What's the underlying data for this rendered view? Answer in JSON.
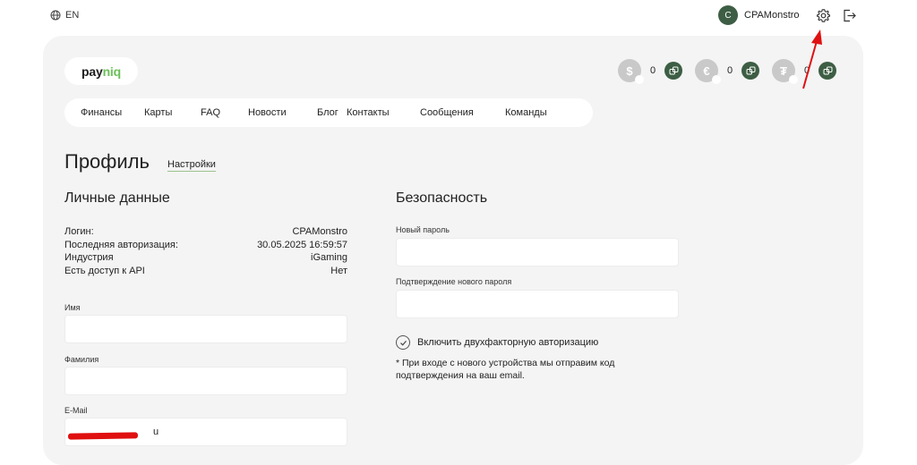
{
  "topbar": {
    "language": "EN",
    "user_initial": "C",
    "username": "CPAMonstro"
  },
  "brand": {
    "logo_text_main": "pay",
    "logo_text_accent": "niq"
  },
  "balances": [
    {
      "symbol": "$",
      "value": "0",
      "icon": "dollar-coin-icon"
    },
    {
      "symbol": "€",
      "value": "0",
      "icon": "euro-coin-icon"
    },
    {
      "symbol": "₮",
      "value": "0",
      "icon": "tether-coin-icon"
    }
  ],
  "nav": {
    "items": [
      "Финансы",
      "Карты",
      "FAQ",
      "Новости",
      "Блог",
      "Контакты",
      "Сообщения",
      "Команды"
    ]
  },
  "page": {
    "title": "Профиль",
    "settings_link": "Настройки"
  },
  "personal": {
    "title": "Личные данные",
    "rows": [
      {
        "label": "Логин:",
        "value": "CPAMonstro"
      },
      {
        "label": "Последняя авторизация:",
        "value": "30.05.2025 16:59:57"
      },
      {
        "label": "Индустрия",
        "value": "iGaming"
      },
      {
        "label": "Есть доступ к API",
        "value": "Нет"
      }
    ],
    "name_label": "Имя",
    "name_value": "",
    "surname_label": "Фамилия",
    "surname_value": "",
    "email_label": "E-Mail",
    "email_value": "u"
  },
  "security": {
    "title": "Безопасность",
    "new_password_label": "Новый пароль",
    "confirm_password_label": "Подтверждение нового пароля",
    "twofa_label": "Включить двухфакторную авторизацию",
    "note": "* При входе с нового устройства мы отправим код подтверждения на ваш email."
  },
  "colors": {
    "accent_green": "#3d5e44",
    "logo_green": "#6cc05a",
    "card_bg": "#f4f4f4",
    "annotation_red": "#e01010"
  }
}
